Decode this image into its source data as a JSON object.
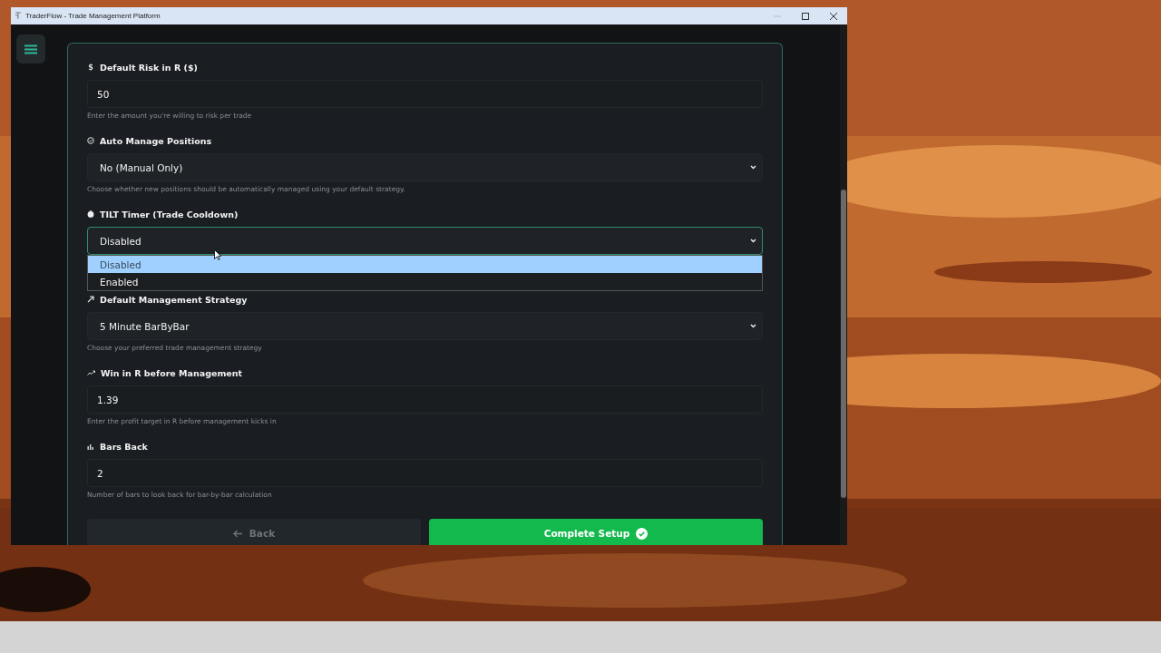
{
  "window": {
    "title": "TraderFlow - Trade Management Platform"
  },
  "fields": [
    {
      "kind": "input",
      "symbol": "$",
      "label": "Default Risk in R ($)",
      "value": "50",
      "help": "Enter the amount you're willing to risk per trade"
    },
    {
      "kind": "select",
      "label": "Auto Manage Positions",
      "value": "No (Manual Only)",
      "help": "Choose whether new positions should be automatically managed using your default strategy."
    },
    {
      "kind": "select",
      "label": "TILT Timer (Trade Cooldown)",
      "value": "Disabled",
      "expanded": true,
      "options": [
        {
          "label": "Disabled",
          "selected": true
        },
        {
          "label": "Enabled",
          "selected": false
        }
      ]
    },
    {
      "kind": "select",
      "label": "Default Management Strategy",
      "value": "5 Minute BarByBar",
      "help": "Choose your preferred trade management strategy"
    },
    {
      "kind": "input",
      "label": "Win in R before Management",
      "value": "1.39",
      "help": "Enter the profit target in R before management kicks in"
    },
    {
      "kind": "input",
      "label": "Bars Back",
      "value": "2",
      "help": "Number of bars to look back for bar-by-bar calculation"
    }
  ],
  "buttons": [
    {
      "kind": "back",
      "label": "Back",
      "disabled": true
    },
    {
      "kind": "primary",
      "label": "Complete Setup",
      "disabled": false
    }
  ]
}
